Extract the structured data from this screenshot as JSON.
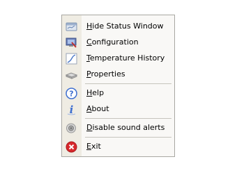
{
  "menu": {
    "items": [
      {
        "mnemonic": "H",
        "rest": "ide Status Window",
        "icon": "status-window-icon"
      },
      {
        "mnemonic": "C",
        "rest": "onfiguration",
        "icon": "configuration-icon"
      },
      {
        "mnemonic": "T",
        "rest": "emperature History",
        "icon": "temperature-graph-icon"
      },
      {
        "mnemonic": "P",
        "rest": "roperties",
        "icon": "properties-icon"
      },
      {
        "mnemonic": "H",
        "rest": "elp",
        "icon": "help-icon"
      },
      {
        "mnemonic": "A",
        "rest": "bout",
        "icon": "info-icon"
      },
      {
        "mnemonic": "D",
        "rest": "isable sound alerts",
        "icon": "speaker-icon"
      },
      {
        "mnemonic": "E",
        "rest": "xit",
        "icon": "exit-icon"
      }
    ]
  },
  "colors": {
    "help_blue": "#3e6fd0",
    "exit_red": "#d8282c",
    "gutter": "#efece3"
  }
}
